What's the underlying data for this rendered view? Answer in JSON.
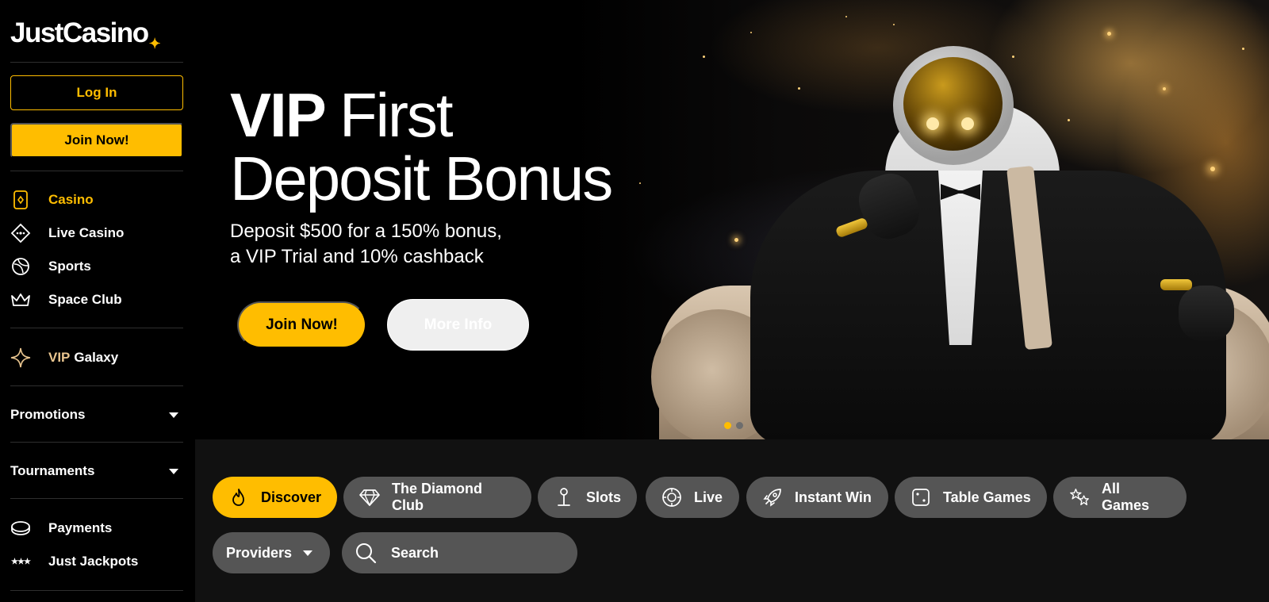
{
  "brand": {
    "name": "JustCasino",
    "accent_color": "#ffbd00"
  },
  "sidebar": {
    "login_label": "Log In",
    "join_label": "Join Now!",
    "nav": [
      {
        "label": "Casino",
        "icon": "casino-card-icon",
        "active": true
      },
      {
        "label": "Live Casino",
        "icon": "live-dealer-chip-icon",
        "active": false
      },
      {
        "label": "Sports",
        "icon": "sports-ball-icon",
        "active": false
      },
      {
        "label": "Space Club",
        "icon": "crown-icon",
        "active": false
      }
    ],
    "vip": {
      "prefix": "VIP",
      "label": "Galaxy",
      "icon": "sparkle-icon"
    },
    "promotions_label": "Promotions",
    "tournaments_label": "Tournaments",
    "payments_label": "Payments",
    "jackpots_label": "Just Jackpots"
  },
  "hero": {
    "title_bold": "VIP",
    "title_rest": "First",
    "title_line2": "Deposit Bonus",
    "subtitle_line1": "Deposit $500 for a 150% bonus,",
    "subtitle_line2": "a VIP Trial and 10% cashback",
    "join_label": "Join Now!",
    "more_label": "More Info",
    "slides_total": 2,
    "slide_active": 1
  },
  "categories": [
    {
      "label": "Discover",
      "icon": "flame-icon",
      "active": true
    },
    {
      "label": "The Diamond Club",
      "icon": "diamond-icon",
      "active": false
    },
    {
      "label": "Slots",
      "icon": "joystick-icon",
      "active": false
    },
    {
      "label": "Live",
      "icon": "roulette-icon",
      "active": false
    },
    {
      "label": "Instant Win",
      "icon": "rocket-icon",
      "active": false
    },
    {
      "label": "Table Games",
      "icon": "dice-icon",
      "active": false
    },
    {
      "label": "All Games",
      "icon": "stars-icon",
      "active": false
    }
  ],
  "filters": {
    "providers_label": "Providers",
    "search_placeholder": "Search"
  }
}
